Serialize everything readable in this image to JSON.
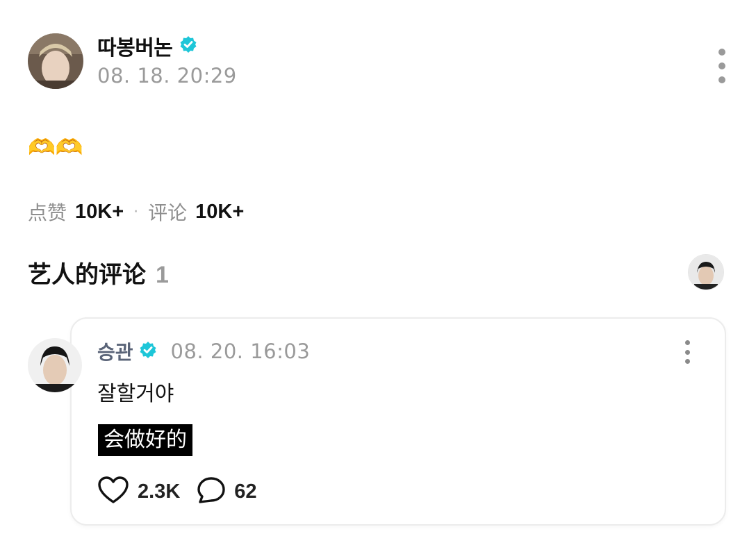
{
  "post": {
    "author": "따봉버논",
    "time": "08. 18. 20:29",
    "body": "🫶🫶",
    "stats": {
      "likes_label": "点赞",
      "likes_value": "10K+",
      "separator": "·",
      "comments_label": "评论",
      "comments_value": "10K+"
    }
  },
  "artist_comments": {
    "heading": "艺人的评论",
    "count": "1"
  },
  "comment": {
    "author": "승관",
    "time": "08. 20. 16:03",
    "text": "잘할거야",
    "translation": "会做好的",
    "likes": "2.3K",
    "replies": "62"
  },
  "colors": {
    "verified_badge": "#1ec6d8",
    "muted_text": "#9a9a9a",
    "card_border": "#ececec"
  },
  "icons": [
    "verified-badge-icon",
    "more-vertical-icon",
    "heart-icon",
    "comment-bubble-icon"
  ]
}
